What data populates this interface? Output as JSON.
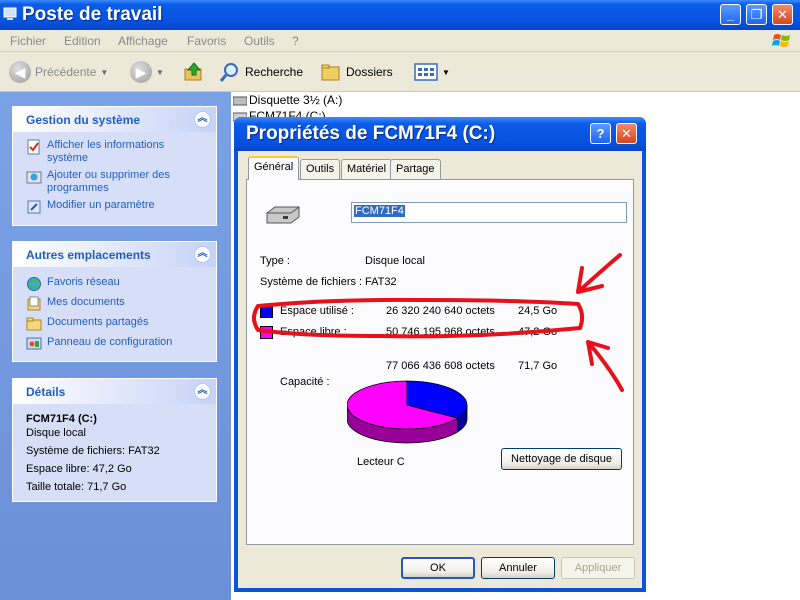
{
  "window": {
    "title": "Poste de travail"
  },
  "menu": [
    "Fichier",
    "Edition",
    "Affichage",
    "Favoris",
    "Outils",
    "?"
  ],
  "toolbar": {
    "back": "Précédente",
    "search": "Recherche",
    "folders": "Dossiers"
  },
  "tasks": {
    "system": {
      "title": "Gestion du système",
      "items": [
        {
          "label": "Afficher les informations système",
          "icon": "system-info-icon"
        },
        {
          "label": "Ajouter ou supprimer des programmes",
          "icon": "add-remove-icon"
        },
        {
          "label": "Modifier un paramètre",
          "icon": "control-icon"
        }
      ]
    },
    "places": {
      "title": "Autres emplacements",
      "items": [
        {
          "label": "Favoris réseau",
          "icon": "network-icon"
        },
        {
          "label": "Mes documents",
          "icon": "documents-icon"
        },
        {
          "label": "Documents partagés",
          "icon": "shared-folder-icon"
        },
        {
          "label": "Panneau de configuration",
          "icon": "control-panel-icon"
        }
      ]
    },
    "details": {
      "title": "Détails",
      "name": "FCM71F4 (C:)",
      "kind": "Disque local",
      "fs": "Système de fichiers: FAT32",
      "free": "Espace libre: 47,2 Go",
      "total": "Taille totale: 71,7 Go"
    }
  },
  "drives": [
    "Disquette 3½ (A:)",
    "FCM71F4 (C:)"
  ],
  "dialog": {
    "title": "Propriétés de FCM71F4 (C:)",
    "tabs": [
      "Général",
      "Outils",
      "Matériel",
      "Partage"
    ],
    "name_value": "FCM71F4",
    "type_label": "Type :",
    "type_value": "Disque local",
    "fs_label": "Système de fichiers :",
    "fs_value": "FAT32",
    "used_label": "Espace utilisé :",
    "used_bytes": "26 320 240 640 octets",
    "used_gb": "24,5 Go",
    "free_label": "Espace libre :",
    "free_bytes": "50 746 195 968 octets",
    "free_gb": "47,2 Go",
    "capacity_label": "Capacité :",
    "capacity_bytes": "77 066 436 608 octets",
    "capacity_gb": "71,7 Go",
    "drive_label": "Lecteur C",
    "cleanup_button": "Nettoyage de disque",
    "ok": "OK",
    "cancel": "Annuler",
    "apply": "Appliquer",
    "used_fraction": 0.3415,
    "colors": {
      "used": "#0000ff",
      "free": "#ff00ff"
    }
  }
}
